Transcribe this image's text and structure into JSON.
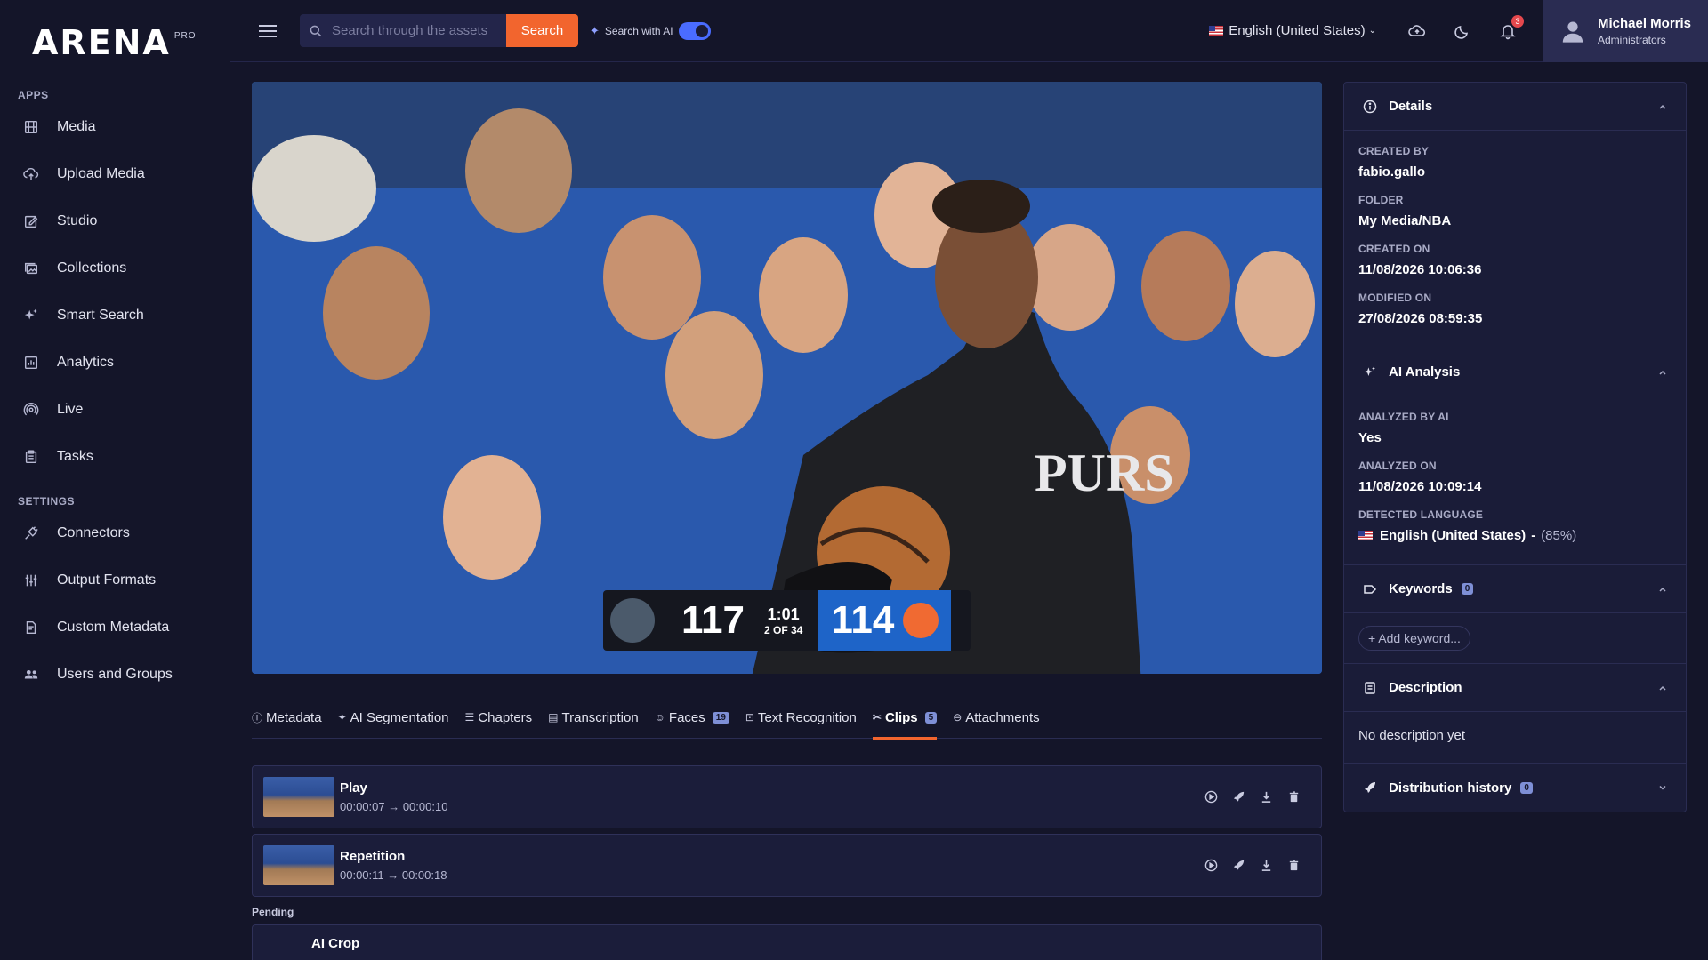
{
  "app": {
    "logo": "ARENA",
    "logo_suffix": "PRO"
  },
  "sidebar": {
    "apps_label": "APPS",
    "settings_label": "SETTINGS",
    "apps": [
      {
        "label": "Media",
        "icon": "film-icon"
      },
      {
        "label": "Upload Media",
        "icon": "cloud-upload-icon"
      },
      {
        "label": "Studio",
        "icon": "edit-icon"
      },
      {
        "label": "Collections",
        "icon": "collections-icon"
      },
      {
        "label": "Smart Search",
        "icon": "sparkles-icon"
      },
      {
        "label": "Analytics",
        "icon": "analytics-icon"
      },
      {
        "label": "Live",
        "icon": "broadcast-icon"
      },
      {
        "label": "Tasks",
        "icon": "clipboard-icon"
      }
    ],
    "settings": [
      {
        "label": "Connectors",
        "icon": "plug-icon"
      },
      {
        "label": "Output Formats",
        "icon": "sliders-icon"
      },
      {
        "label": "Custom Metadata",
        "icon": "document-edit-icon"
      },
      {
        "label": "Users and Groups",
        "icon": "users-icon"
      }
    ]
  },
  "topbar": {
    "search_placeholder": "Search through the assets",
    "search_button": "Search",
    "ai_search_label": "Search with AI",
    "ai_search_enabled": true,
    "language": "English (United States)",
    "notification_count": "3",
    "user_name": "Michael Morris",
    "user_role": "Administrators"
  },
  "video": {
    "scoreboard": {
      "home_score": "117",
      "away_score": "114",
      "clock": "1:01",
      "period": "2 OF 34"
    }
  },
  "tabs": [
    {
      "label": "Metadata",
      "icon": "ⓘ",
      "active": false
    },
    {
      "label": "AI Segmentation",
      "icon": "✦",
      "active": false
    },
    {
      "label": "Chapters",
      "icon": "☰",
      "active": false
    },
    {
      "label": "Transcription",
      "icon": "▤",
      "active": false
    },
    {
      "label": "Faces",
      "icon": "☺",
      "badge": "19",
      "active": false
    },
    {
      "label": "Text Recognition",
      "icon": "⊡",
      "active": false
    },
    {
      "label": "Clips",
      "icon": "✂",
      "badge": "5",
      "active": true
    },
    {
      "label": "Attachments",
      "icon": "⊖",
      "active": false
    }
  ],
  "clips": [
    {
      "title": "Play",
      "time": "00:00:07 → 00:00:10"
    },
    {
      "title": "Repetition",
      "time": "00:00:11 → 00:00:18"
    }
  ],
  "pending": {
    "label": "Pending",
    "title": "AI Crop"
  },
  "details": {
    "title": "Details",
    "fields": [
      {
        "label": "CREATED BY",
        "value": "fabio.gallo"
      },
      {
        "label": "FOLDER",
        "value": "My Media/NBA"
      },
      {
        "label": "CREATED ON",
        "value": "11/08/2026 10:06:36"
      },
      {
        "label": "MODIFIED ON",
        "value": "27/08/2026 08:59:35"
      }
    ]
  },
  "ai_analysis": {
    "title": "AI Analysis",
    "analyzed_label": "ANALYZED BY AI",
    "analyzed_value": "Yes",
    "analyzed_on_label": "ANALYZED ON",
    "analyzed_on_value": "11/08/2026 10:09:14",
    "language_label": "DETECTED LANGUAGE",
    "language_value": "English (United States)",
    "language_confidence": "(85%)"
  },
  "keywords": {
    "title": "Keywords",
    "count": "0",
    "add_label": "+ Add keyword..."
  },
  "description": {
    "title": "Description",
    "text": "No description yet"
  },
  "distribution": {
    "title": "Distribution history",
    "count": "0"
  },
  "colors": {
    "accent": "#f2652e",
    "background": "#141529",
    "toggle": "#4a6cff"
  }
}
